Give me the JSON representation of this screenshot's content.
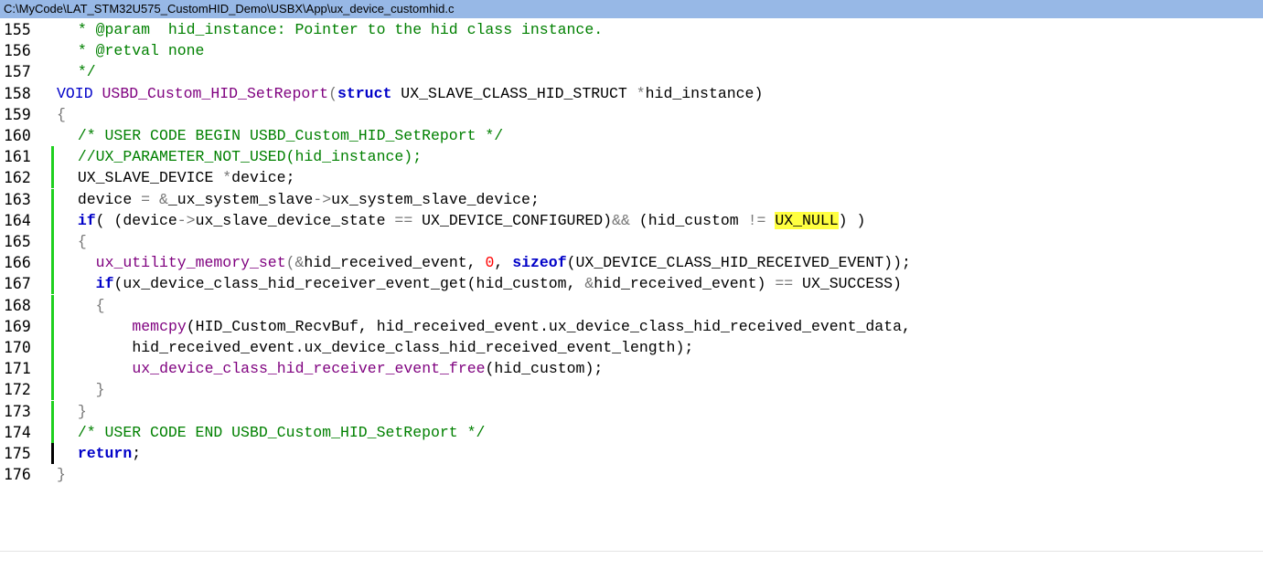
{
  "window": {
    "title": "C:\\MyCode\\LAT_STM32U575_CustomHID_Demo\\USBX\\App\\ux_device_customhid.c"
  },
  "colors": {
    "title_bar": "#97b8e6",
    "comment": "#008000",
    "keyword": "#0000c8",
    "function": "#7f007f",
    "number": "#ff0000",
    "change_marker": "#1fd01f",
    "highlight": "#ffff40"
  },
  "lines": [
    {
      "num": "155",
      "marker": "none",
      "indent": 2,
      "tokens": [
        {
          "t": "* @param  hid_instance: Pointer to the hid class instance.",
          "c": "cm"
        }
      ]
    },
    {
      "num": "156",
      "marker": "none",
      "indent": 2,
      "tokens": [
        {
          "t": "* @retval none",
          "c": "cm"
        }
      ]
    },
    {
      "num": "157",
      "marker": "none",
      "indent": 2,
      "tokens": [
        {
          "t": "*/",
          "c": "cm"
        }
      ]
    },
    {
      "num": "158",
      "marker": "none",
      "indent": 0,
      "tokens": [
        {
          "t": "VOID ",
          "c": "kw2"
        },
        {
          "t": "USBD_Custom_HID_SetReport",
          "c": "fn"
        },
        {
          "t": "(",
          "c": "op"
        },
        {
          "t": "struct",
          "c": "kw"
        },
        {
          "t": " UX_SLAVE_CLASS_HID_STRUCT ",
          "c": ""
        },
        {
          "t": "*",
          "c": "op"
        },
        {
          "t": "hid_instance)",
          "c": ""
        }
      ]
    },
    {
      "num": "159",
      "marker": "none",
      "indent": 0,
      "tokens": [
        {
          "t": "{",
          "c": "op"
        }
      ]
    },
    {
      "num": "160",
      "marker": "none",
      "indent": 2,
      "tokens": [
        {
          "t": "/* USER CODE BEGIN USBD_Custom_HID_SetReport */",
          "c": "cm"
        }
      ]
    },
    {
      "num": "161",
      "marker": "green",
      "indent": 2,
      "tokens": [
        {
          "t": "//UX_PARAMETER_NOT_USED(hid_instance);",
          "c": "cm"
        }
      ]
    },
    {
      "num": "162",
      "marker": "green",
      "indent": 2,
      "tokens": [
        {
          "t": "UX_SLAVE_DEVICE ",
          "c": ""
        },
        {
          "t": "*",
          "c": "op"
        },
        {
          "t": "device;",
          "c": ""
        }
      ]
    },
    {
      "num": "163",
      "marker": "green",
      "indent": 2,
      "tokens": [
        {
          "t": "device ",
          "c": ""
        },
        {
          "t": "=",
          "c": "op"
        },
        {
          "t": " ",
          "c": ""
        },
        {
          "t": "&",
          "c": "op"
        },
        {
          "t": "_ux_system_slave",
          "c": ""
        },
        {
          "t": "->",
          "c": "op"
        },
        {
          "t": "ux_system_slave_device;",
          "c": ""
        }
      ]
    },
    {
      "num": "164",
      "marker": "green",
      "indent": 2,
      "tokens": [
        {
          "t": "if",
          "c": "kw"
        },
        {
          "t": "( (device",
          "c": ""
        },
        {
          "t": "->",
          "c": "op"
        },
        {
          "t": "ux_slave_device_state ",
          "c": ""
        },
        {
          "t": "==",
          "c": "op"
        },
        {
          "t": " UX_DEVICE_CONFIGURED)",
          "c": ""
        },
        {
          "t": "&&",
          "c": "op"
        },
        {
          "t": " (hid_custom ",
          "c": ""
        },
        {
          "t": "!=",
          "c": "op"
        },
        {
          "t": " ",
          "c": ""
        },
        {
          "t": "UX_NULL",
          "c": "hl"
        },
        {
          "t": ") )",
          "c": ""
        }
      ]
    },
    {
      "num": "165",
      "marker": "green",
      "indent": 2,
      "tokens": [
        {
          "t": "{",
          "c": "op"
        }
      ]
    },
    {
      "num": "166",
      "marker": "green",
      "indent": 4,
      "tokens": [
        {
          "t": "ux_utility_memory_set",
          "c": "fn"
        },
        {
          "t": "(",
          "c": "op"
        },
        {
          "t": "&",
          "c": "op"
        },
        {
          "t": "hid_received_event, ",
          "c": ""
        },
        {
          "t": "0",
          "c": "num"
        },
        {
          "t": ", ",
          "c": ""
        },
        {
          "t": "sizeof",
          "c": "kw"
        },
        {
          "t": "(UX_DEVICE_CLASS_HID_RECEIVED_EVENT));",
          "c": ""
        }
      ]
    },
    {
      "num": "167",
      "marker": "green",
      "indent": 4,
      "tokens": [
        {
          "t": "if",
          "c": "kw"
        },
        {
          "t": "(ux_device_class_hid_receiver_event_get(hid_custom, ",
          "c": ""
        },
        {
          "t": "&",
          "c": "op"
        },
        {
          "t": "hid_received_event) ",
          "c": ""
        },
        {
          "t": "==",
          "c": "op"
        },
        {
          "t": " UX_SUCCESS)",
          "c": ""
        }
      ]
    },
    {
      "num": "168",
      "marker": "green",
      "indent": 4,
      "tokens": [
        {
          "t": "{",
          "c": "op"
        }
      ]
    },
    {
      "num": "169",
      "marker": "green",
      "indent": 8,
      "tokens": [
        {
          "t": "memcpy",
          "c": "fn"
        },
        {
          "t": "(HID_Custom_RecvBuf, hid_received_event.ux_device_class_hid_received_event_data,",
          "c": ""
        }
      ]
    },
    {
      "num": "170",
      "marker": "green",
      "indent": 8,
      "tokens": [
        {
          "t": "hid_received_event.ux_device_class_hid_received_event_length);",
          "c": ""
        }
      ]
    },
    {
      "num": "171",
      "marker": "green",
      "indent": 8,
      "tokens": [
        {
          "t": "ux_device_class_hid_receiver_event_free",
          "c": "fn"
        },
        {
          "t": "(hid_custom);",
          "c": ""
        }
      ]
    },
    {
      "num": "172",
      "marker": "green",
      "indent": 4,
      "tokens": [
        {
          "t": "}",
          "c": "op"
        }
      ]
    },
    {
      "num": "173",
      "marker": "green",
      "indent": 2,
      "tokens": [
        {
          "t": "}",
          "c": "op"
        }
      ]
    },
    {
      "num": "174",
      "marker": "green",
      "indent": 2,
      "tokens": [
        {
          "t": "/* USER CODE END USBD_Custom_HID_SetReport */",
          "c": "cm"
        }
      ]
    },
    {
      "num": "175",
      "marker": "black",
      "indent": 2,
      "tokens": [
        {
          "t": "return",
          "c": "kw"
        },
        {
          "t": ";",
          "c": ""
        }
      ]
    },
    {
      "num": "176",
      "marker": "none",
      "indent": 0,
      "tokens": [
        {
          "t": "}",
          "c": "op"
        }
      ]
    }
  ]
}
